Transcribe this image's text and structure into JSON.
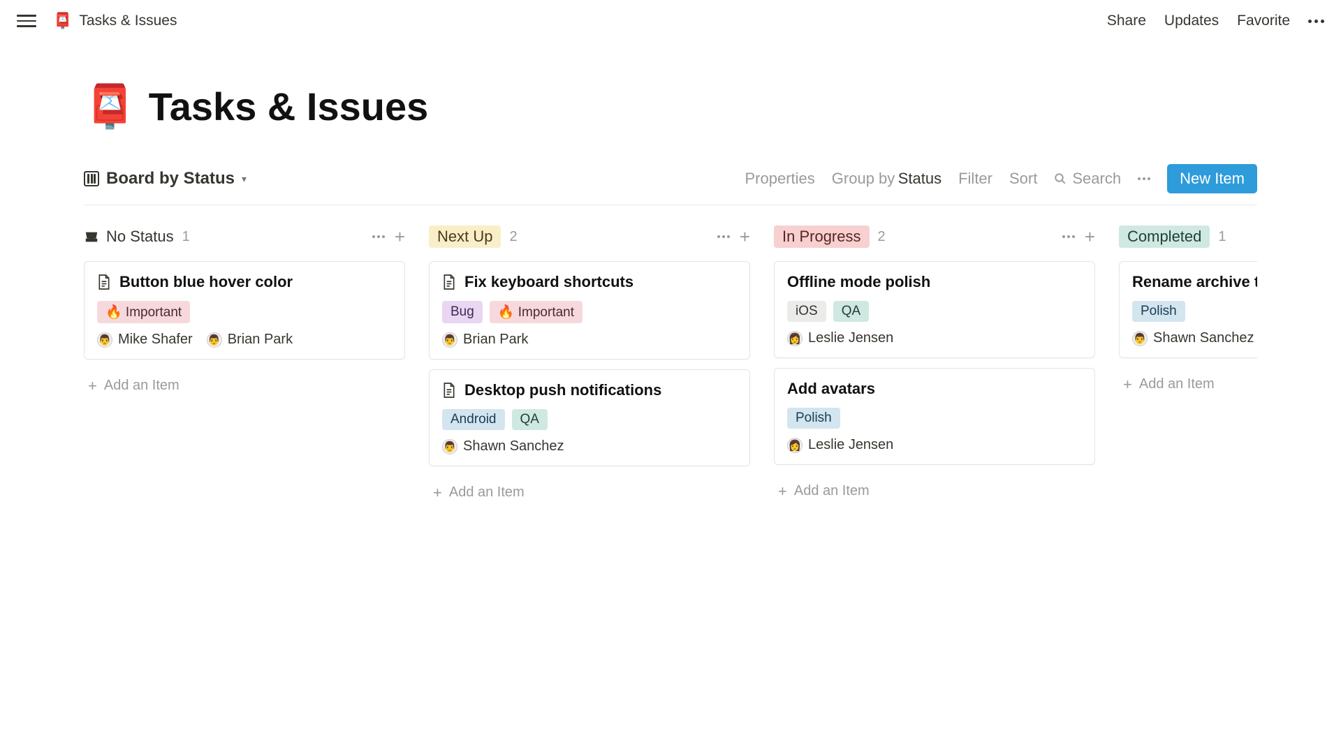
{
  "header": {
    "icon": "📮",
    "breadcrumb_title": "Tasks & Issues",
    "actions": {
      "share": "Share",
      "updates": "Updates",
      "favorite": "Favorite"
    }
  },
  "page": {
    "icon": "📮",
    "title": "Tasks & Issues"
  },
  "toolbar": {
    "view_name": "Board by Status",
    "properties": "Properties",
    "group_by_label": "Group by",
    "group_by_value": "Status",
    "filter": "Filter",
    "sort": "Sort",
    "search": "Search",
    "new_item": "New Item"
  },
  "columns": [
    {
      "key": "no_status",
      "label": "No Status",
      "count": "1",
      "tag_bg": "none",
      "cards": [
        {
          "has_doc_icon": true,
          "title": "Button blue hover color",
          "tags": [
            {
              "label": "🔥 Important",
              "bg": "bg-pink"
            }
          ],
          "people": [
            {
              "name": "Mike Shafer",
              "avatar": "👨"
            },
            {
              "name": "Brian Park",
              "avatar": "👨"
            }
          ]
        }
      ],
      "add_label": "Add an Item"
    },
    {
      "key": "next_up",
      "label": "Next Up",
      "count": "2",
      "tag_bg": "bg-yellow",
      "cards": [
        {
          "has_doc_icon": true,
          "title": "Fix keyboard shortcuts",
          "tags": [
            {
              "label": "Bug",
              "bg": "bg-purple"
            },
            {
              "label": "🔥 Important",
              "bg": "bg-pink"
            }
          ],
          "people": [
            {
              "name": "Brian Park",
              "avatar": "👨"
            }
          ]
        },
        {
          "has_doc_icon": true,
          "title": "Desktop push notifications",
          "tags": [
            {
              "label": "Android",
              "bg": "bg-blue"
            },
            {
              "label": "QA",
              "bg": "bg-teal"
            }
          ],
          "people": [
            {
              "name": "Shawn Sanchez",
              "avatar": "👨"
            }
          ]
        }
      ],
      "add_label": "Add an Item"
    },
    {
      "key": "in_progress",
      "label": "In Progress",
      "count": "2",
      "tag_bg": "bg-red",
      "cards": [
        {
          "has_doc_icon": false,
          "title": "Offline mode polish",
          "tags": [
            {
              "label": "iOS",
              "bg": "bg-gray"
            },
            {
              "label": "QA",
              "bg": "bg-teal"
            }
          ],
          "people": [
            {
              "name": "Leslie Jensen",
              "avatar": "👩"
            }
          ]
        },
        {
          "has_doc_icon": false,
          "title": "Add avatars",
          "tags": [
            {
              "label": "Polish",
              "bg": "bg-blue"
            }
          ],
          "people": [
            {
              "name": "Leslie Jensen",
              "avatar": "👩"
            }
          ]
        }
      ],
      "add_label": "Add an Item"
    },
    {
      "key": "completed",
      "label": "Completed",
      "count": "1",
      "tag_bg": "bg-teal",
      "cards": [
        {
          "has_doc_icon": false,
          "title": "Rename archive to trash",
          "tags": [
            {
              "label": "Polish",
              "bg": "bg-blue"
            }
          ],
          "people": [
            {
              "name": "Shawn Sanchez",
              "avatar": "👨"
            }
          ]
        }
      ],
      "add_label": "Add an Item"
    }
  ]
}
